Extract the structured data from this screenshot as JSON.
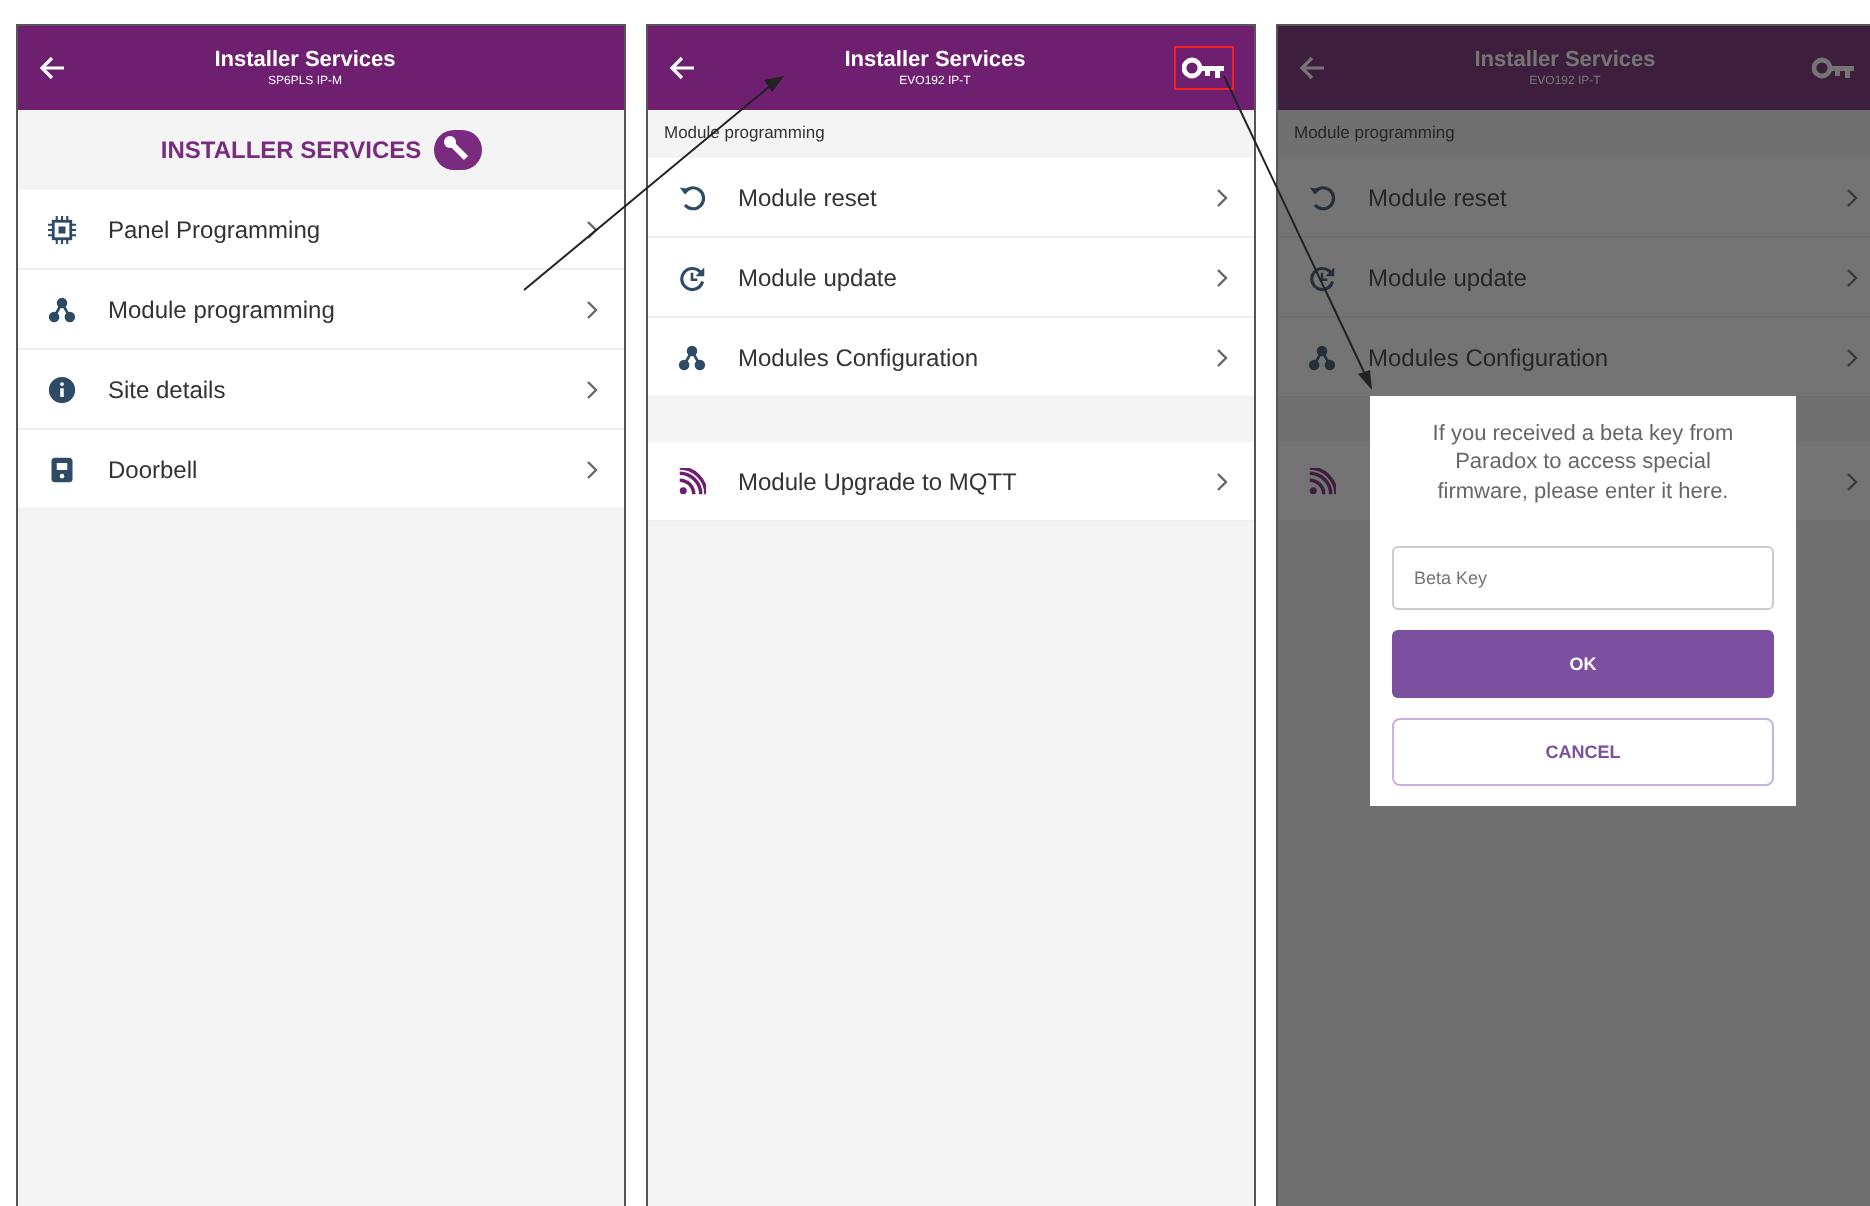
{
  "screens": [
    {
      "header": {
        "title": "Installer Services",
        "subtitle": "SP6PLS IP-M"
      },
      "banner": {
        "text": "INSTALLER SERVICES"
      },
      "groups": [
        [
          {
            "kind": "chip",
            "label": "Panel Programming"
          },
          {
            "kind": "nodes",
            "label": "Module programming"
          },
          {
            "kind": "info",
            "label": "Site details"
          },
          {
            "kind": "doorbell",
            "label": "Doorbell"
          }
        ]
      ],
      "dimmed": false
    },
    {
      "header": {
        "title": "Installer Services",
        "subtitle": "EVO192 IP-T",
        "action": {
          "kind": "key",
          "highlighted": true
        }
      },
      "section_title": "Module programming",
      "groups": [
        [
          {
            "kind": "reset",
            "label": "Module reset"
          },
          {
            "kind": "update",
            "label": "Module update"
          },
          {
            "kind": "nodes",
            "label": "Modules Configuration"
          }
        ],
        [
          {
            "kind": "rss",
            "label": "Module Upgrade to MQTT"
          }
        ]
      ],
      "dimmed": false
    },
    {
      "header": {
        "title": "Installer Services",
        "subtitle": "EVO192 IP-T",
        "action": {
          "kind": "key",
          "highlighted": false
        }
      },
      "section_title": "Module programming",
      "groups": [
        [
          {
            "kind": "reset",
            "label": "Module reset"
          },
          {
            "kind": "update",
            "label": "Module update"
          },
          {
            "kind": "nodes",
            "label": "Modules Configuration"
          }
        ],
        [
          {
            "kind": "rss"
          }
        ]
      ],
      "dimmed": true,
      "dialog": {
        "message": "If you received a beta key from Paradox to access special firmware, please enter it here.",
        "placeholder": "Beta Key",
        "ok": "OK",
        "cancel": "CANCEL"
      }
    }
  ]
}
